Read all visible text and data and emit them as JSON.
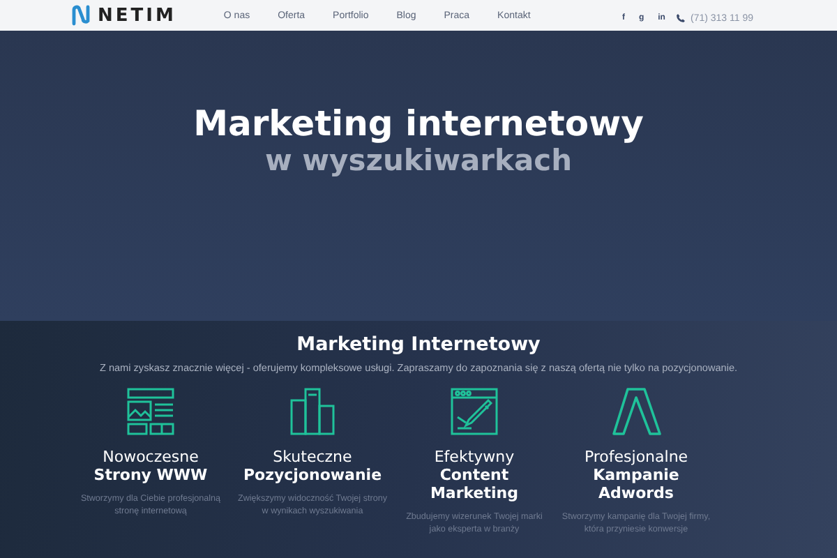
{
  "header": {
    "logo": "NETIM",
    "nav": [
      {
        "label": "O nas"
      },
      {
        "label": "Oferta"
      },
      {
        "label": "Portfolio"
      },
      {
        "label": "Blog"
      },
      {
        "label": "Praca"
      },
      {
        "label": "Kontakt"
      }
    ],
    "social": [
      "f",
      "g",
      "in"
    ],
    "phone": "(71) 313 11 99"
  },
  "hero": {
    "title": "Marketing internetowy",
    "subtitle": "w wyszukiwarkach"
  },
  "services": {
    "heading": "Marketing Internetowy",
    "intro": "Z nami zyskasz znacznie więcej - oferujemy kompleksowe usługi. Zapraszamy do zapoznania się z naszą ofertą nie tylko na pozycjonowanie.",
    "items": [
      {
        "kind": "website",
        "title": "Nowoczesne",
        "title_bold": "Strony WWW",
        "text": "Stworzymy dla Ciebie profesjonalną stronę internetową"
      },
      {
        "kind": "podium",
        "title": "Skuteczne",
        "title_bold": "Pozycjonowanie",
        "text": "Zwiększymy widoczność Twojej strony w wynikach wyszukiwania"
      },
      {
        "kind": "editor",
        "title": "Efektywny",
        "title_bold": "Content Marketing",
        "text": "Zbudujemy wizerunek Twojej marki jako eksperta w branży"
      },
      {
        "kind": "ads",
        "title": "Profesjonalne",
        "title_bold": "Kampanie Adwords",
        "text": "Stworzymy kampanię dla Twojej firmy, która przyniesie konwersje"
      }
    ]
  }
}
